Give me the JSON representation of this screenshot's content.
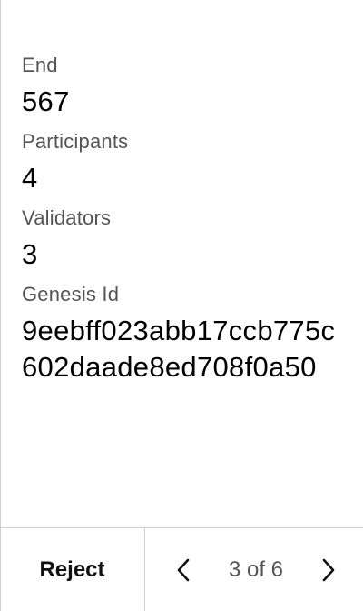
{
  "fields": [
    {
      "label": "End",
      "value": "567"
    },
    {
      "label": "Participants",
      "value": "4"
    },
    {
      "label": "Validators",
      "value": "3"
    },
    {
      "label": "Genesis Id",
      "value": "9eebff023abb17ccb775c602daade8ed708f0a50"
    }
  ],
  "footer": {
    "reject_label": "Reject",
    "page_indicator": "3 of 6",
    "prev_icon": "chevron-left-icon",
    "next_icon": "chevron-right-icon"
  }
}
